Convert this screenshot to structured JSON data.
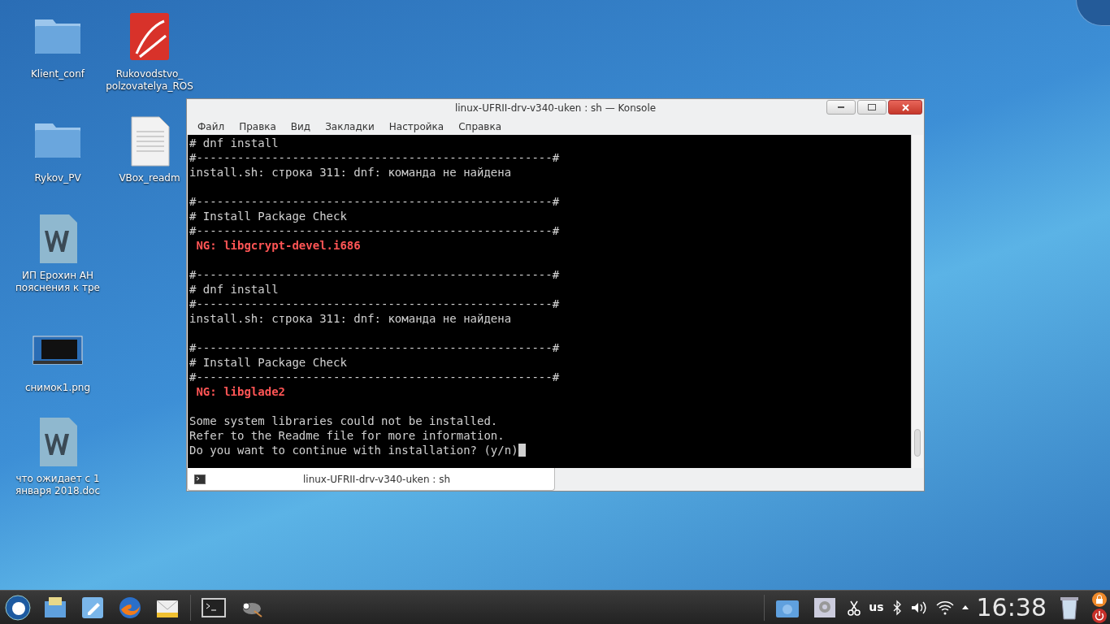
{
  "desktop_icons": [
    {
      "kind": "folder",
      "lines": [
        "Klient_conf"
      ]
    },
    {
      "kind": "pdf",
      "lines": [
        "Rukovodstvo_",
        "polzovatelya_ROS"
      ]
    },
    {
      "kind": "folder",
      "lines": [
        "Rykov_PV"
      ]
    },
    {
      "kind": "text",
      "lines": [
        "VBox_readm"
      ]
    },
    {
      "kind": "word",
      "lines": [
        "ИП Ерохин АН",
        "пояснения к тре"
      ]
    },
    {
      "kind": "image",
      "lines": [
        "снимок1.png"
      ]
    },
    {
      "kind": "word",
      "lines": [
        "что ожидает с 1",
        "января 2018.doc"
      ]
    }
  ],
  "window": {
    "title": "linux-UFRII-drv-v340-uken : sh — Konsole",
    "menu": [
      "Файл",
      "Правка",
      "Вид",
      "Закладки",
      "Настройка",
      "Справка"
    ],
    "terminal_lines": [
      {
        "kind": "text",
        "text": "# dnf install"
      },
      {
        "kind": "text",
        "text": "#----------------------------------------------------#"
      },
      {
        "kind": "text",
        "text": "install.sh: строка 311: dnf: команда не найдена"
      },
      {
        "kind": "blank"
      },
      {
        "kind": "text",
        "text": "#----------------------------------------------------#"
      },
      {
        "kind": "text",
        "text": "# Install Package Check"
      },
      {
        "kind": "text",
        "text": "#----------------------------------------------------#"
      },
      {
        "kind": "error",
        "text": " NG: libgcrypt-devel.i686"
      },
      {
        "kind": "blank"
      },
      {
        "kind": "text",
        "text": "#----------------------------------------------------#"
      },
      {
        "kind": "text",
        "text": "# dnf install"
      },
      {
        "kind": "text",
        "text": "#----------------------------------------------------#"
      },
      {
        "kind": "text",
        "text": "install.sh: строка 311: dnf: команда не найдена"
      },
      {
        "kind": "blank"
      },
      {
        "kind": "text",
        "text": "#----------------------------------------------------#"
      },
      {
        "kind": "text",
        "text": "# Install Package Check"
      },
      {
        "kind": "text",
        "text": "#----------------------------------------------------#"
      },
      {
        "kind": "error",
        "text": " NG: libglade2"
      },
      {
        "kind": "blank"
      },
      {
        "kind": "text",
        "text": "Some system libraries could not be installed."
      },
      {
        "kind": "text",
        "text": "Refer to the Readme file for more information."
      },
      {
        "kind": "prompt",
        "text": "Do you want to continue with installation? (y/n)"
      }
    ],
    "tabs": [
      {
        "label": "linux-UFRII-drv-v340-uken : sh",
        "selected": true
      }
    ]
  },
  "taskbar": {
    "keyboard_layout": "us",
    "clock": "16:38"
  }
}
